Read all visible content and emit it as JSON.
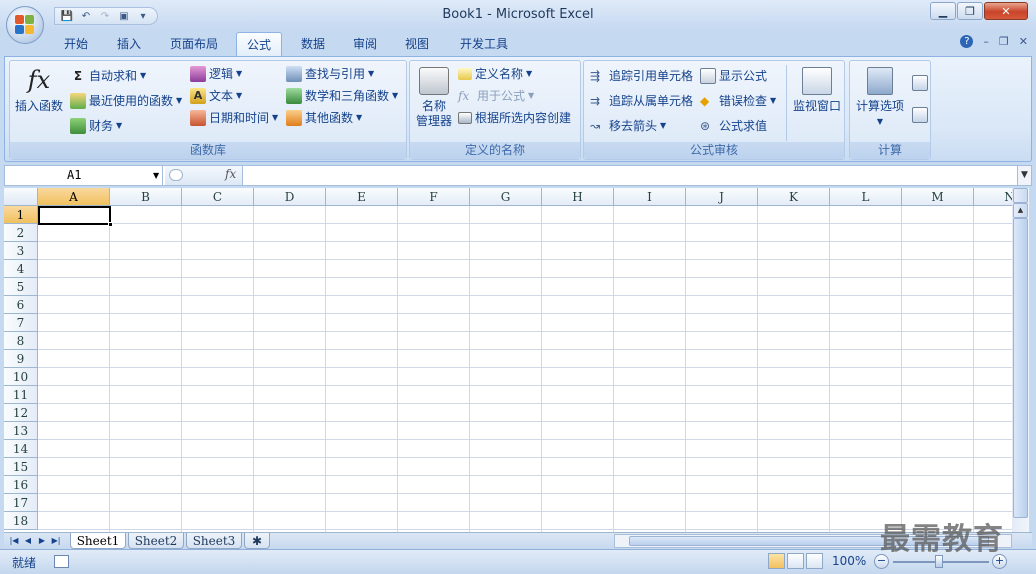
{
  "window": {
    "title": "Book1 - Microsoft Excel",
    "controls": {
      "minimize": "▁",
      "maximize": "❐",
      "close": "✕"
    }
  },
  "qat": {
    "save_icon": "💾",
    "undo": "↶",
    "redo": "↷",
    "preview": "▣",
    "customize": "▾"
  },
  "tabs": [
    "开始",
    "插入",
    "页面布局",
    "公式",
    "数据",
    "审阅",
    "视图",
    "开发工具"
  ],
  "active_tab": "公式",
  "ribbon_controls": {
    "help": "?",
    "minimize": "–",
    "restore": "❐",
    "close": "✕"
  },
  "groups": {
    "function_library": {
      "label": "函数库",
      "insert_function": "插入函数",
      "autosum": "自动求和",
      "recent": "最近使用的函数",
      "financial": "财务",
      "logical": "逻辑",
      "text": "文本",
      "datetime": "日期和时间",
      "lookup": "查找与引用",
      "math": "数学和三角函数",
      "more": "其他函数"
    },
    "defined_names": {
      "label": "定义的名称",
      "name_manager_1": "名称",
      "name_manager_2": "管理器",
      "define_name": "定义名称",
      "use_in_formula": "用于公式",
      "create_from_selection": "根据所选内容创建"
    },
    "formula_auditing": {
      "label": "公式审核",
      "trace_precedents": "追踪引用单元格",
      "trace_dependents": "追踪从属单元格",
      "remove_arrows": "移去箭头",
      "show_formulas": "显示公式",
      "error_checking": "错误检查",
      "evaluate": "公式求值",
      "watch_window": "监视窗口"
    },
    "calculation": {
      "label": "计算",
      "options": "计算选项"
    }
  },
  "formula_bar": {
    "name_box": "A1",
    "fx": "fx",
    "content": ""
  },
  "columns": [
    "A",
    "B",
    "C",
    "D",
    "E",
    "F",
    "G",
    "H",
    "I",
    "J",
    "K",
    "L",
    "M",
    "N"
  ],
  "rows": [
    "1",
    "2",
    "3",
    "4",
    "5",
    "6",
    "7",
    "8",
    "9",
    "10",
    "11",
    "12",
    "13",
    "14",
    "15",
    "16",
    "17",
    "18"
  ],
  "selected_cell": "A1",
  "sheets": [
    "Sheet1",
    "Sheet2",
    "Sheet3"
  ],
  "active_sheet": "Sheet1",
  "status": {
    "ready": "就绪",
    "zoom": "100%"
  },
  "watermark": "最需教育",
  "colors": {
    "accent": "#15428b",
    "ribbon_bg": "#dbe8f7",
    "selection": "#f1c15f"
  }
}
